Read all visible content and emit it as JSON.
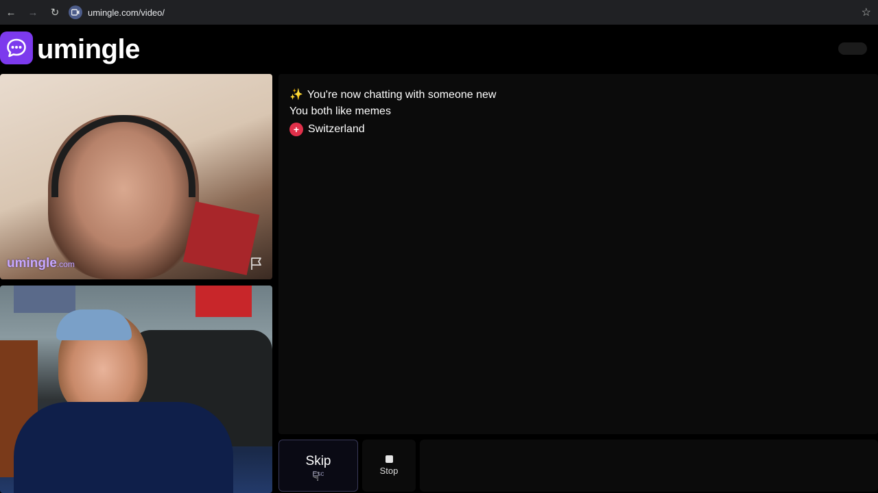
{
  "browser": {
    "url": "umingle.com/video/",
    "back_icon": "arrow-left-icon",
    "forward_icon": "arrow-right-icon",
    "reload_icon": "reload-icon",
    "bookmark_icon": "star-icon"
  },
  "header": {
    "logo_text": "umingle",
    "logo_icon": "chat-bubble-icon",
    "brand_color": "#7c3aed"
  },
  "videos": {
    "stranger": {
      "watermark_main": "umingle",
      "watermark_suffix": ".com",
      "report_icon": "flag-icon"
    },
    "self": {}
  },
  "chat": {
    "messages": [
      {
        "icon": "sparkle-icon",
        "text": "You're now chatting with someone new"
      },
      {
        "text": "You both like memes"
      },
      {
        "icon": "swiss-flag-icon",
        "text": "Switzerland"
      }
    ]
  },
  "controls": {
    "skip_label": "Skip",
    "skip_shortcut": "Esc",
    "stop_label": "Stop",
    "stop_icon": "stop-square-icon"
  }
}
